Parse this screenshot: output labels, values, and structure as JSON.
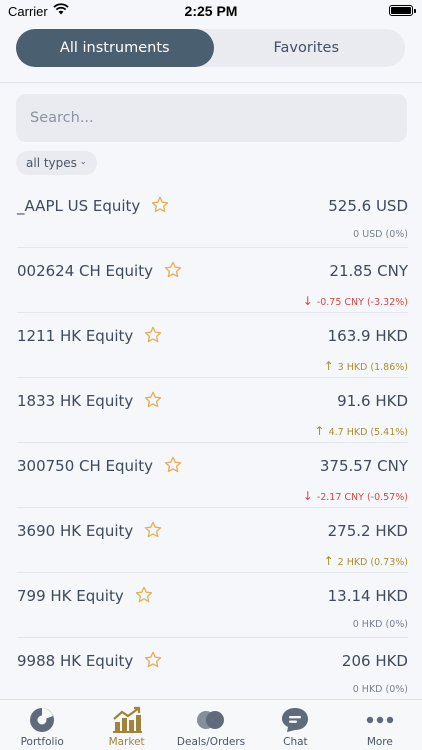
{
  "status_bar": {
    "carrier": "Carrier",
    "time": "2:25 PM"
  },
  "tabs": [
    {
      "label": "All instruments",
      "active": true
    },
    {
      "label": "Favorites",
      "active": false
    }
  ],
  "search": {
    "placeholder": "Search...",
    "value": ""
  },
  "filter": {
    "label": "all types"
  },
  "colors": {
    "up": "#a6902e",
    "down": "#cf4b45",
    "neutral": "#7a8290",
    "star": "#e3b157",
    "accent": "#a0843c",
    "segment_active": "#4a6070"
  },
  "instruments": [
    {
      "name": "_AAPL US Equity",
      "price": "525.6 USD",
      "change": "0 USD (0%)",
      "direction": "none"
    },
    {
      "name": "002624 CH Equity",
      "price": "21.85 CNY",
      "change": "-0.75 CNY (-3.32%)",
      "direction": "down"
    },
    {
      "name": "1211 HK Equity",
      "price": "163.9 HKD",
      "change": "3 HKD (1.86%)",
      "direction": "up"
    },
    {
      "name": "1833 HK Equity",
      "price": "91.6 HKD",
      "change": "4.7 HKD (5.41%)",
      "direction": "up"
    },
    {
      "name": "300750 CH Equity",
      "price": "375.57 CNY",
      "change": "-2.17 CNY (-0.57%)",
      "direction": "down"
    },
    {
      "name": "3690 HK Equity",
      "price": "275.2 HKD",
      "change": "2 HKD (0.73%)",
      "direction": "up"
    },
    {
      "name": "799 HK Equity",
      "price": "13.14 HKD",
      "change": "0 HKD (0%)",
      "direction": "none"
    },
    {
      "name": "9988 HK Equity",
      "price": "206 HKD",
      "change": "0 HKD (0%)",
      "direction": "none"
    }
  ],
  "tab_bar": [
    {
      "label": "Portfolio",
      "icon": "portfolio-pie-icon",
      "active": false
    },
    {
      "label": "Market",
      "icon": "market-chart-icon",
      "active": true
    },
    {
      "label": "Deals/Orders",
      "icon": "deals-orders-icon",
      "active": false
    },
    {
      "label": "Chat",
      "icon": "chat-bubble-icon",
      "active": false
    },
    {
      "label": "More",
      "icon": "more-dots-icon",
      "active": false
    }
  ]
}
